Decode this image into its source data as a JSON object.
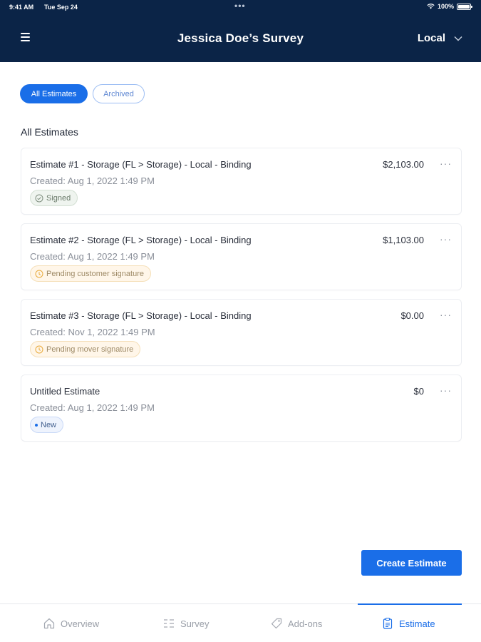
{
  "status_bar": {
    "time": "9:41 AM",
    "date": "Tue Sep 24",
    "battery": "100%"
  },
  "header": {
    "title": "Jessica Doe’s Survey",
    "mode": "Local"
  },
  "filters": [
    {
      "label": "All Estimates",
      "active": true
    },
    {
      "label": "Archived",
      "active": false
    }
  ],
  "section_title": "All Estimates",
  "estimates": [
    {
      "title": "Estimate #1 - Storage (FL > Storage) - Local - Binding",
      "amount": "$2,103.00",
      "created": "Created: Aug 1, 2022 1:49 PM",
      "status": "Signed",
      "status_type": "signed"
    },
    {
      "title": "Estimate #2 - Storage (FL > Storage) - Local - Binding",
      "amount": "$1,103.00",
      "created": "Created: Aug 1, 2022 1:49 PM",
      "status": "Pending customer signature",
      "status_type": "pending"
    },
    {
      "title": "Estimate #3 - Storage (FL > Storage) - Local - Binding",
      "amount": "$0.00",
      "created": "Created: Nov 1, 2022 1:49 PM",
      "status": "Pending mover signature",
      "status_type": "pending"
    },
    {
      "title": "Untitled Estimate",
      "amount": "$0",
      "created": "Created: Aug 1, 2022 1:49 PM",
      "status": "New",
      "status_type": "new"
    }
  ],
  "more_label": "···",
  "create_button": "Create Estimate",
  "tabs": [
    {
      "label": "Overview",
      "icon": "home-icon"
    },
    {
      "label": "Survey",
      "icon": "checklist-icon"
    },
    {
      "label": "Add-ons",
      "icon": "tag-icon"
    },
    {
      "label": "Estimate",
      "icon": "clipboard-icon",
      "active": true
    }
  ],
  "colors": {
    "header_bg": "#0b2447",
    "accent": "#1a6ee8",
    "signed": "#6a7a6a",
    "pending": "#e8a93a"
  }
}
